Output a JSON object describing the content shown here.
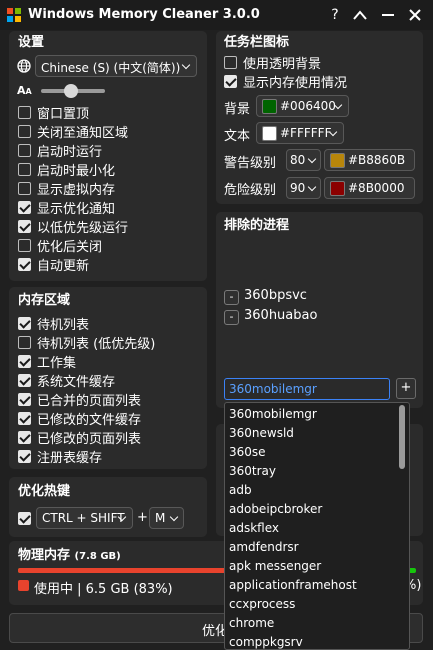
{
  "titlebar": {
    "title": "Windows Memory Cleaner 3.0.0",
    "help": "?",
    "collapse": "",
    "minimize": "",
    "close": "✕"
  },
  "settings": {
    "title": "设置",
    "language": "Chinese (S) (中文(简体))",
    "options": [
      {
        "label": "窗口置顶",
        "checked": false
      },
      {
        "label": "关闭至通知区域",
        "checked": false
      },
      {
        "label": "启动时运行",
        "checked": false
      },
      {
        "label": "启动时最小化",
        "checked": false
      },
      {
        "label": "显示虚拟内存",
        "checked": false
      },
      {
        "label": "显示优化通知",
        "checked": true
      },
      {
        "label": "以低优先级运行",
        "checked": true
      },
      {
        "label": "优化后关闭",
        "checked": false
      },
      {
        "label": "自动更新",
        "checked": true
      }
    ]
  },
  "memory_areas": {
    "title": "内存区域",
    "options": [
      {
        "label": "待机列表",
        "checked": true
      },
      {
        "label": "待机列表 (低优先级)",
        "checked": false
      },
      {
        "label": "工作集",
        "checked": true
      },
      {
        "label": "系统文件缓存",
        "checked": true
      },
      {
        "label": "已合并的页面列表",
        "checked": true
      },
      {
        "label": "已修改的文件缓存",
        "checked": true
      },
      {
        "label": "已修改的页面列表",
        "checked": true
      },
      {
        "label": "注册表缓存",
        "checked": true
      }
    ]
  },
  "hotkey": {
    "title": "优化热键",
    "modifier": "CTRL + SHIFT",
    "plus": "+",
    "key": "M"
  },
  "physical_memory": {
    "title": "物理内存",
    "total": "(7.8 GB)",
    "usage_text": "使用中 | 6.5 GB (83%)",
    "usage_fraction": 0.83,
    "right_fragment": "%)",
    "colors": {
      "used": "#e8432d",
      "free": "#16c60c"
    }
  },
  "optimize_button": {
    "label": "优化"
  },
  "tray_icon": {
    "title": "任务栏图标",
    "transparent": {
      "label": "使用透明背景",
      "checked": false
    },
    "show_usage": {
      "label": "显示内存使用情况",
      "checked": true
    },
    "background": {
      "label": "背景",
      "value": "#006400",
      "color": "#006400"
    },
    "text": {
      "label": "文本",
      "value": "#FFFFFF",
      "color": "#FFFFFF"
    },
    "warning": {
      "label": "警告级别",
      "level": "80",
      "value": "#B8860B",
      "color": "#B8860B"
    },
    "danger": {
      "label": "危险级别",
      "level": "90",
      "value": "#8B0000",
      "color": "#8B0000"
    }
  },
  "excluded": {
    "title": "排除的进程",
    "items": [
      "360bpsvc",
      "360huabao"
    ],
    "remove_label": "-",
    "selected": "360mobilemgr",
    "add_label": "+"
  },
  "dropdown_options": [
    "360mobilemgr",
    "360newsld",
    "360se",
    "360tray",
    "adb",
    "adobeipcbroker",
    "adskflex",
    "amdfendrsr",
    "apk messenger",
    "applicationframehost",
    "ccxprocess",
    "chrome",
    "comppkgsrv"
  ]
}
